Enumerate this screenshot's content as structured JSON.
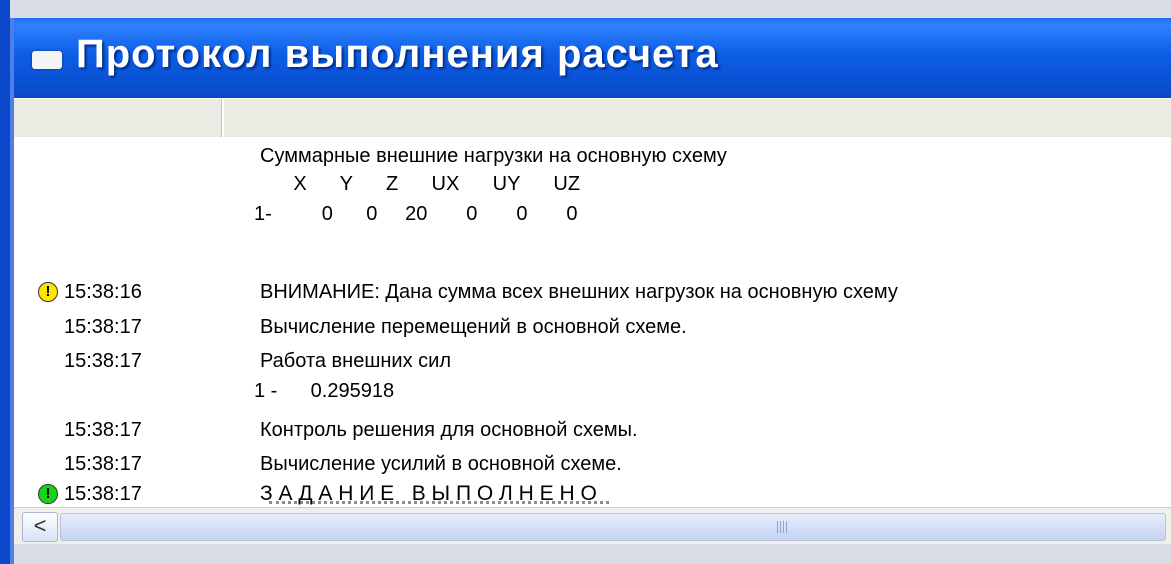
{
  "window": {
    "title": "Протокол выполнения расчета"
  },
  "summary": {
    "heading": "Суммарные внешние  нагрузки на основную схему",
    "columns_line": "      X      Y      Z      UX      UY      UZ",
    "values_line": "1-         0      0     20       0       0       0"
  },
  "log": [
    {
      "time": "15:38:16",
      "icon": "warning-icon",
      "icon_glyph": "!",
      "message": "ВНИМАНИЕ: Дана сумма всех внешних нагрузок на основную схему"
    },
    {
      "time": "15:38:17",
      "message": "Вычисление перемещений в основной схеме."
    },
    {
      "time": "15:38:17",
      "message": "Работа внешних сил"
    },
    {
      "detail": "1 -      0.295918"
    },
    {
      "time": "15:38:17",
      "message": "Контроль решения для основной схемы."
    },
    {
      "time": "15:38:17",
      "message": "Вычисление усилий в основной схеме."
    },
    {
      "time": "15:38:17",
      "icon": "success-icon",
      "icon_glyph": "!",
      "message": "З А Д А Н И Е   В Ы П О Л Н Е Н О"
    }
  ],
  "scrollbar": {
    "left_arrow": "<"
  },
  "colors": {
    "title_bar": "#0a53d6",
    "warning": "#ffe600",
    "success": "#14d614"
  }
}
